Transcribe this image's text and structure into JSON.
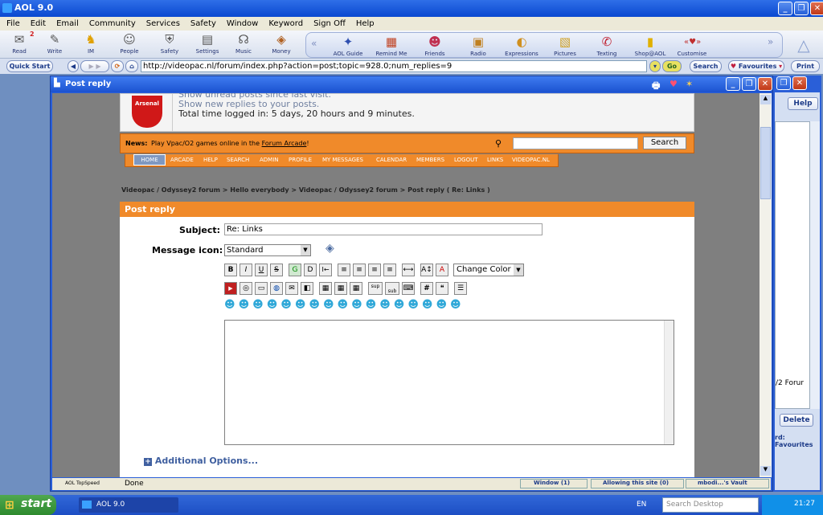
{
  "app": {
    "title": "AOL 9.0"
  },
  "menu": [
    "File",
    "Edit",
    "Email",
    "Community",
    "Services",
    "Safety",
    "Window",
    "Keyword",
    "Sign Off",
    "Help"
  ],
  "toolbar": {
    "items": [
      {
        "label": "Read",
        "icon": "envelope-icon"
      },
      {
        "label": "Write",
        "icon": "pencil-icon"
      },
      {
        "label": "IM",
        "icon": "running-man-icon"
      },
      {
        "label": "People",
        "icon": "people-icon"
      },
      {
        "label": "Safety",
        "icon": "shield-icon"
      },
      {
        "label": "Settings",
        "icon": "settings-icon"
      },
      {
        "label": "Music",
        "icon": "headphones-icon"
      },
      {
        "label": "Money",
        "icon": "money-icon"
      }
    ],
    "read_badge": "2",
    "group": [
      {
        "label": "AOL Guide"
      },
      {
        "label": "Remind Me"
      },
      {
        "label": "Friends"
      },
      {
        "label": "Radio"
      },
      {
        "label": "Expressions"
      },
      {
        "label": "Pictures"
      },
      {
        "label": "Texting"
      },
      {
        "label": "Shop@AOL"
      },
      {
        "label": "Customise"
      }
    ]
  },
  "nav": {
    "quick_start": "Quick Start",
    "address": "http://videopac.nl/forum/index.php?action=post;topic=928.0;num_replies=9",
    "go": "Go",
    "search": "Search",
    "favourites": "Favourites",
    "print": "Print"
  },
  "child": {
    "title": "Post reply"
  },
  "forum": {
    "avatar_caption": "Arsenal",
    "show_unread": "Show unread posts since last visit.",
    "show_new": "Show new replies to your posts.",
    "time_logged": "Total time logged in: 5 days, 20 hours and 9 minutes.",
    "news_label": "News:",
    "news_text": "Play Vpac/O2 games online in the",
    "news_link": "Forum Arcade",
    "news_end": "!",
    "search_button": "Search",
    "tabs": [
      "HOME",
      "ARCADE",
      "HELP",
      "SEARCH",
      "ADMIN",
      "PROFILE",
      "MY MESSAGES",
      "CALENDAR",
      "MEMBERS",
      "LOGOUT",
      "LINKS",
      "VIDEOPAC.NL"
    ],
    "breadcrumb": "Videopac / Odyssey2 forum > Hello everybody > Videopac / Odyssey2 forum > Post reply ( Re: Links )",
    "post_header": "Post reply",
    "subject_label": "Subject:",
    "subject_value": "Re: Links",
    "icon_label": "Message icon:",
    "icon_value": "Standard",
    "change_color": "Change Color",
    "format_row1": [
      "B",
      "I",
      "U",
      "S",
      "G",
      "D",
      "I←"
    ],
    "format_row2": [
      "sup",
      "sub"
    ],
    "fmt_hash": "#",
    "additional": "Additional Options..."
  },
  "status": {
    "addon": "AOL TopSpeed",
    "done": "Done",
    "window": "Window (1)",
    "allowing": "Allowing this site (0)",
    "vault": "mbodi...'s Vault"
  },
  "side": {
    "help": "Help",
    "forum_frag": "/2 Forur",
    "delete": "Delete",
    "fav_frag": "rd: Favourites"
  },
  "taskbar": {
    "start": "start",
    "task": "AOL 9.0",
    "lang": "EN",
    "search_placeholder": "Search Desktop",
    "clock": "21:27"
  },
  "colors": {
    "orange": "#f08a2a",
    "blue": "#2a5fd8"
  }
}
